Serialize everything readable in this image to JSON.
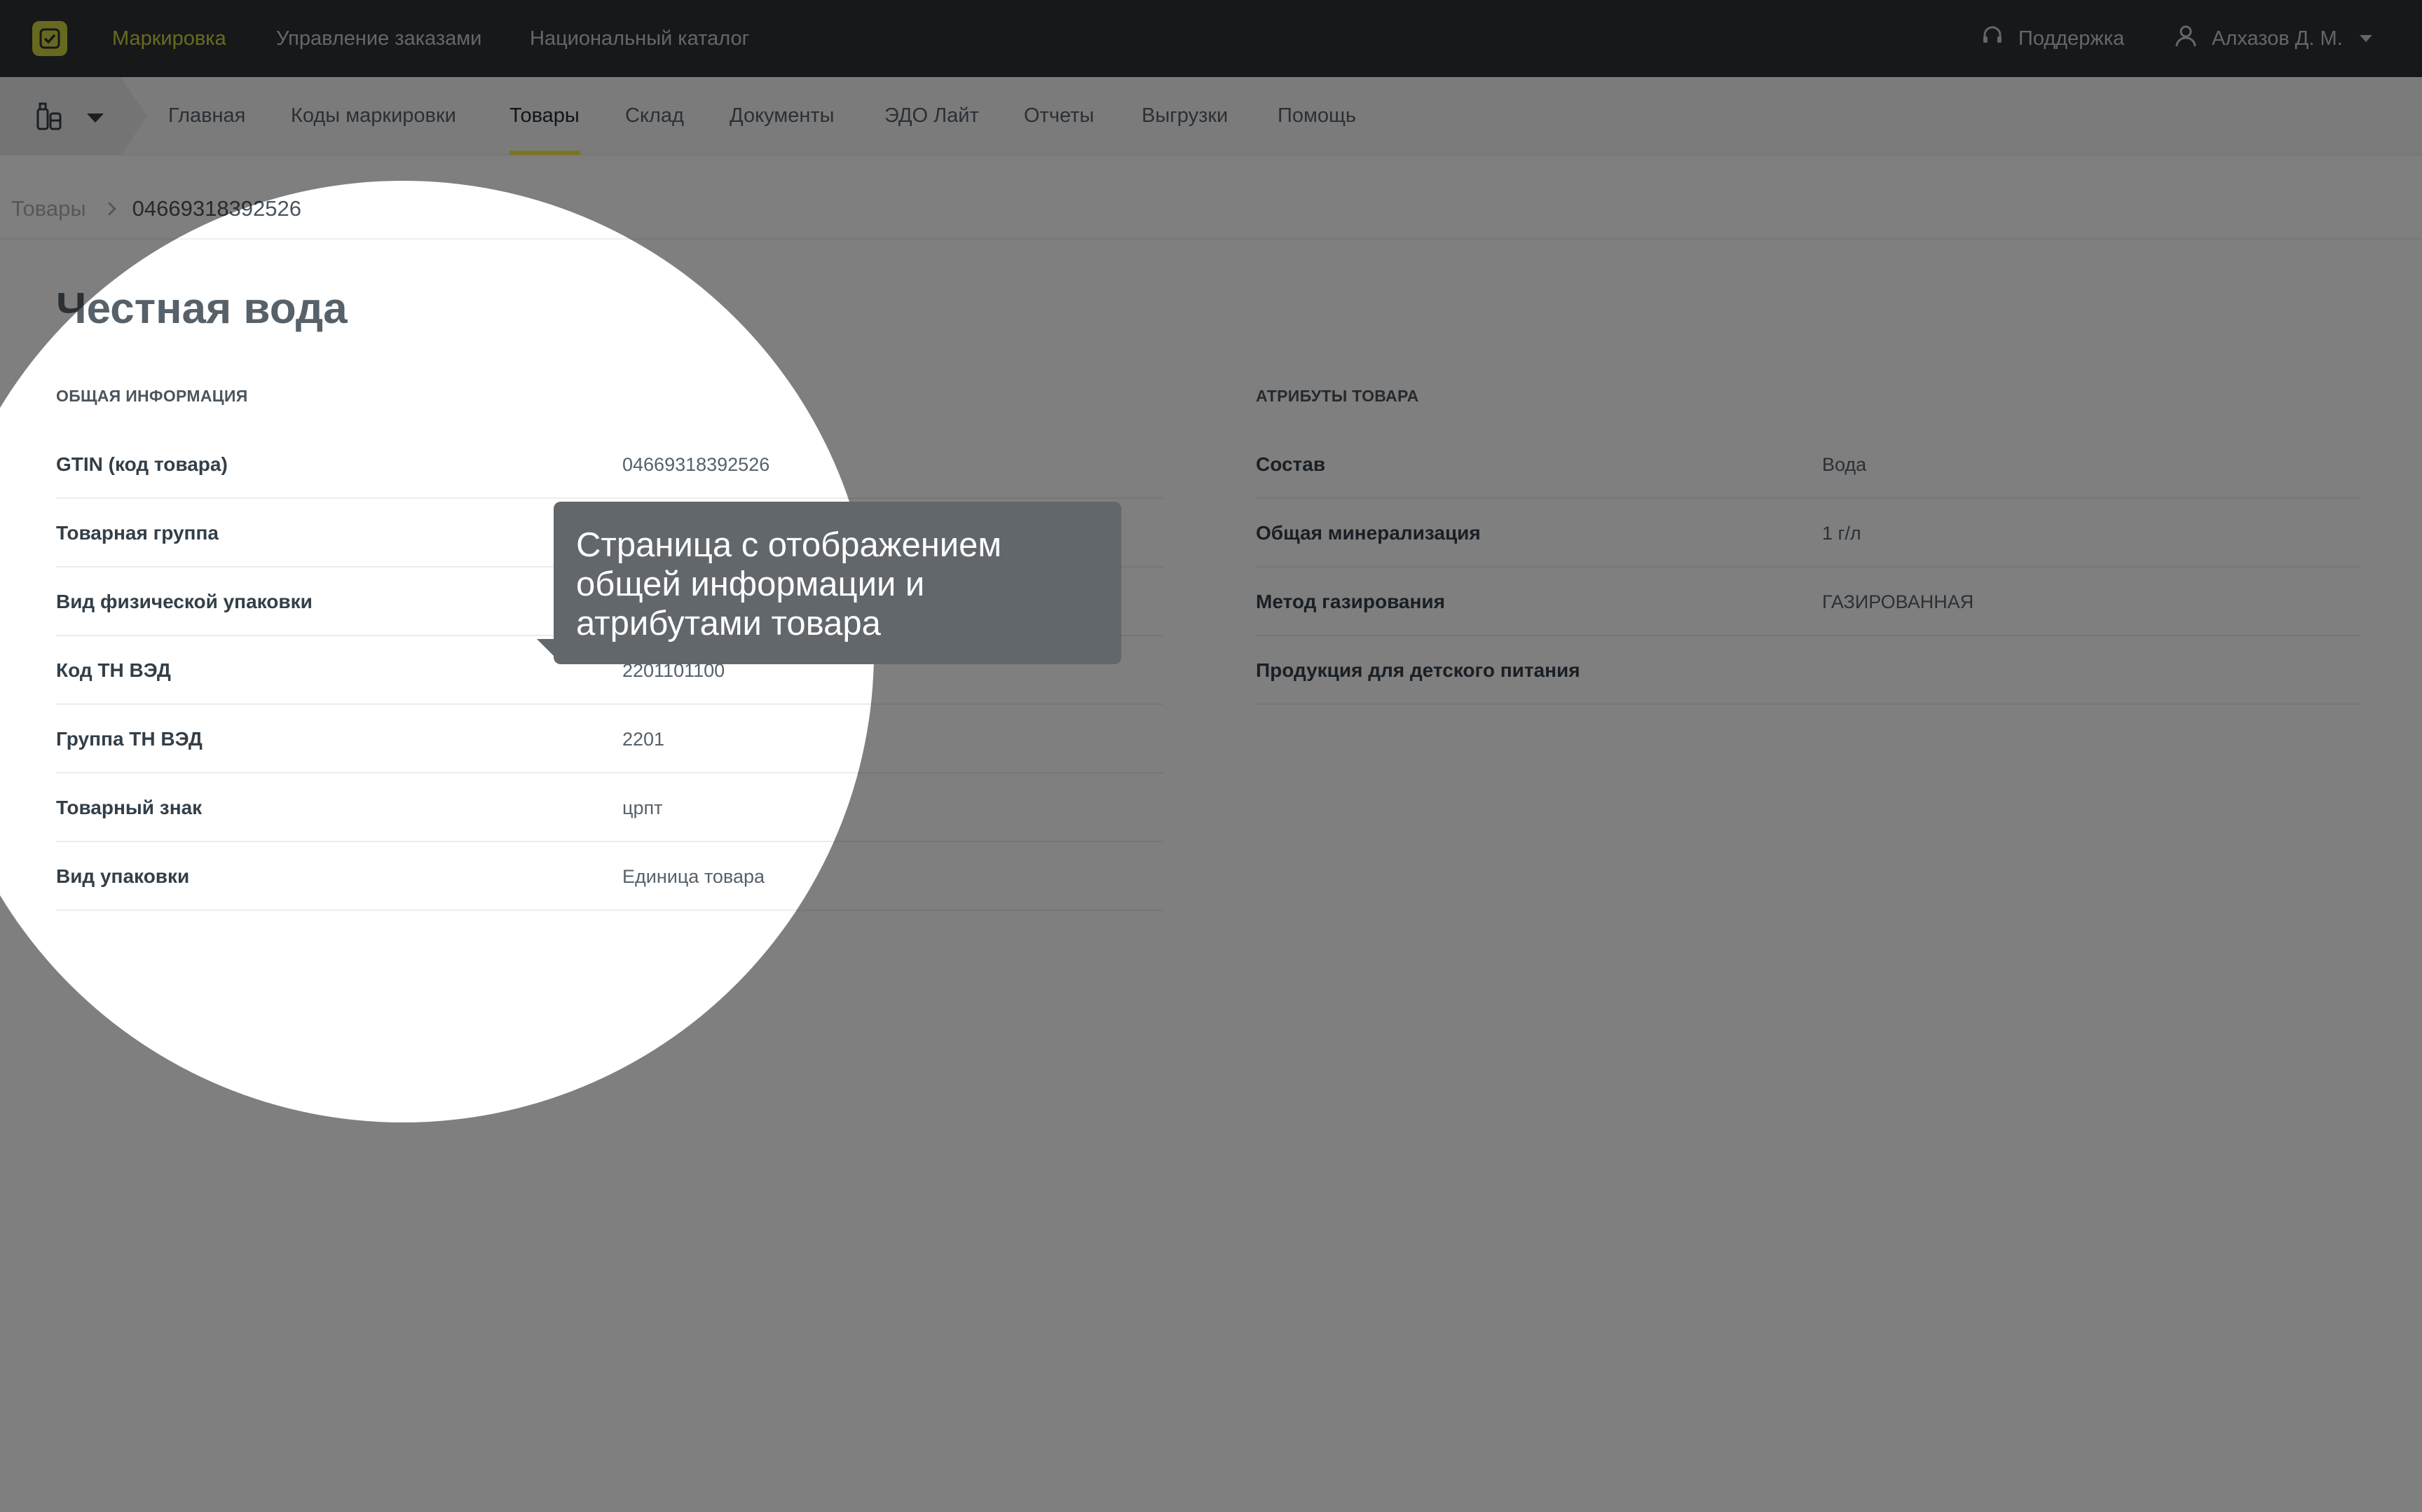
{
  "topbar": {
    "nav": [
      "Маркировка",
      "Управление заказами",
      "Национальный каталог"
    ],
    "support_label": "Поддержка",
    "user_name": "Алхазов Д. М.",
    "accent": "#d3d540"
  },
  "subnav": {
    "items": [
      "Главная",
      "Коды маркировки",
      "Товары",
      "Склад",
      "Документы",
      "ЭДО Лайт",
      "Отчеты",
      "Выгрузки",
      "Помощь"
    ],
    "active": "Товары"
  },
  "breadcrumb": {
    "parent": "Товары",
    "current": "04669318392526"
  },
  "product": {
    "title": "Честная вода",
    "general": {
      "heading": "Общая информация",
      "rows": [
        {
          "label": "GTIN (код товара)",
          "value": "04669318392526"
        },
        {
          "label": "Товарная группа",
          "value": ""
        },
        {
          "label": "Вид физической упаковки",
          "value": ""
        },
        {
          "label": "Код ТН ВЭД",
          "value": "2201101100"
        },
        {
          "label": "Группа ТН ВЭД",
          "value": "2201"
        },
        {
          "label": "Товарный знак",
          "value": "црпт"
        },
        {
          "label": "Вид упаковки",
          "value": "Единица товара"
        }
      ]
    },
    "attributes": {
      "heading": "Атрибуты товара",
      "rows": [
        {
          "label": "Состав",
          "value": "Вода"
        },
        {
          "label": "Общая минерализация",
          "value": "1 г/л"
        },
        {
          "label": "Метод газирования",
          "value": "ГАЗИРОВАННАЯ"
        },
        {
          "label": "Продукция для детского питания",
          "value": ""
        }
      ]
    }
  },
  "tooltip": {
    "line1": "Страница с отображением",
    "line2": "общей информации и",
    "line3": "атрибутами товара"
  },
  "icons": [
    "logo-icon",
    "support-headset-icon",
    "user-icon",
    "product-group-icon",
    "chevron-right-icon"
  ]
}
